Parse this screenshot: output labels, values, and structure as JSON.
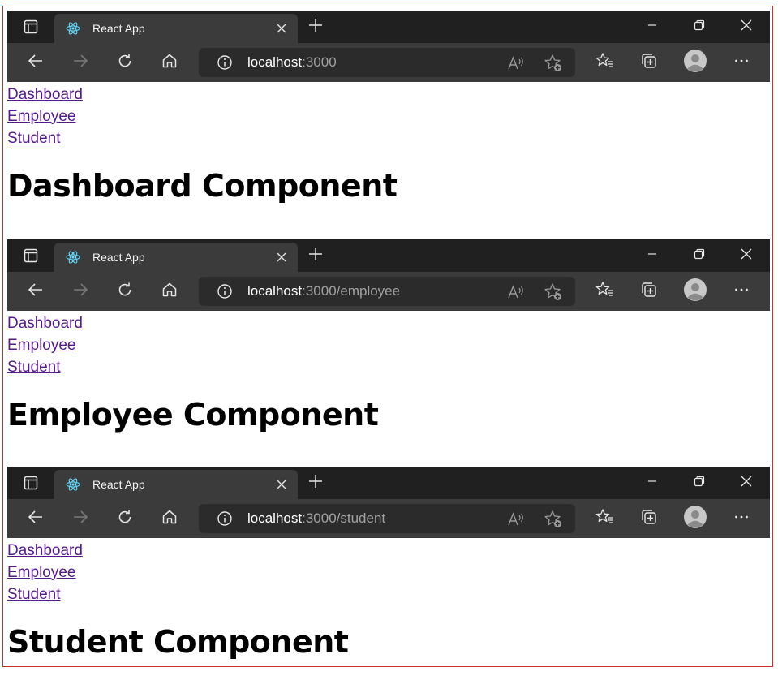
{
  "panels": [
    {
      "tab": {
        "title": "React App",
        "favicon": "react-logo-icon"
      },
      "address": {
        "host": "localhost",
        "path": ":3000"
      },
      "nav_links": [
        "Dashboard",
        "Employee",
        "Student"
      ],
      "heading": "Dashboard Component"
    },
    {
      "tab": {
        "title": "React App",
        "favicon": "react-logo-icon"
      },
      "address": {
        "host": "localhost",
        "path": ":3000/employee"
      },
      "nav_links": [
        "Dashboard",
        "Employee",
        "Student"
      ],
      "heading": "Employee Component"
    },
    {
      "tab": {
        "title": "React App",
        "favicon": "react-logo-icon"
      },
      "address": {
        "host": "localhost",
        "path": ":3000/student"
      },
      "nav_links": [
        "Dashboard",
        "Employee",
        "Student"
      ],
      "heading": "Student Component"
    }
  ],
  "icons": {
    "sidebar": "tab-actions-icon",
    "close": "close-icon",
    "newtab": "plus-icon",
    "minimize": "minimize-icon",
    "restore": "restore-icon",
    "window_close": "window-close-icon",
    "back": "back-arrow-icon",
    "forward": "forward-arrow-icon",
    "refresh": "refresh-icon",
    "home": "home-icon",
    "info": "info-icon",
    "readaloud": "read-aloud-icon",
    "add_favorite": "add-favorite-icon",
    "favorites": "favorites-icon",
    "collections": "collections-icon",
    "profile": "profile-avatar-icon",
    "more": "more-icon"
  },
  "colors": {
    "titlebar": "#202020",
    "toolbar": "#3b3b3b",
    "address_bar": "#2b2b2b",
    "link_visited": "#551a8b",
    "frame_border": "#c9302c"
  }
}
